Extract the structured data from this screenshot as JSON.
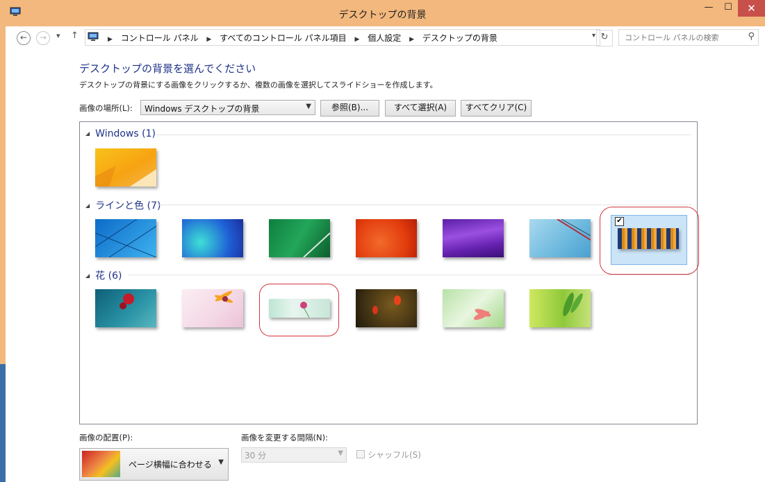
{
  "window": {
    "title": "デスクトップの背景",
    "minimize": "—",
    "maximize": "☐",
    "close": "✕"
  },
  "nav": {
    "back": "←",
    "forward": "→",
    "recent": "▾",
    "up": "↑",
    "breadcrumbs": [
      "コントロール パネル",
      "すべてのコントロール パネル項目",
      "個人設定",
      "デスクトップの背景"
    ],
    "refresh": "↻",
    "search_placeholder": "コントロール パネルの検索"
  },
  "page": {
    "heading": "デスクトップの背景を選んでください",
    "description": "デスクトップの背景にする画像をクリックするか、複数の画像を選択してスライドショーを作成します。",
    "location_label": "画像の場所(L):",
    "location_value": "Windows デスクトップの背景",
    "browse_button": "参照(B)...",
    "select_all_button": "すべて選択(A)",
    "clear_all_button": "すべてクリア(C)"
  },
  "gallery": {
    "groups": [
      {
        "title": "Windows (1)",
        "count": 1
      },
      {
        "title": "ラインと色 (7)",
        "count": 7
      },
      {
        "title": "花 (6)",
        "count": 6
      }
    ],
    "selected": {
      "group": 1,
      "index": 6,
      "checked": true,
      "check_mark": "✔"
    },
    "annotations": [
      {
        "color": "#d2343c",
        "target": "ラインと色 #7"
      },
      {
        "color": "#d2343c",
        "target": "花 #3"
      }
    ]
  },
  "bottom": {
    "position_label": "画像の配置(P):",
    "position_value": "ページ横幅に合わせる",
    "interval_label": "画像を変更する間隔(N):",
    "interval_value": "30 分",
    "shuffle_label": "シャッフル(S)",
    "shuffle_checked": false
  },
  "colors": {
    "titlebar": "#f3b87d",
    "close_button": "#c7504b",
    "heading": "#1e3287",
    "selection_fill": "#cce4f7",
    "annotation": "#d2343c"
  }
}
